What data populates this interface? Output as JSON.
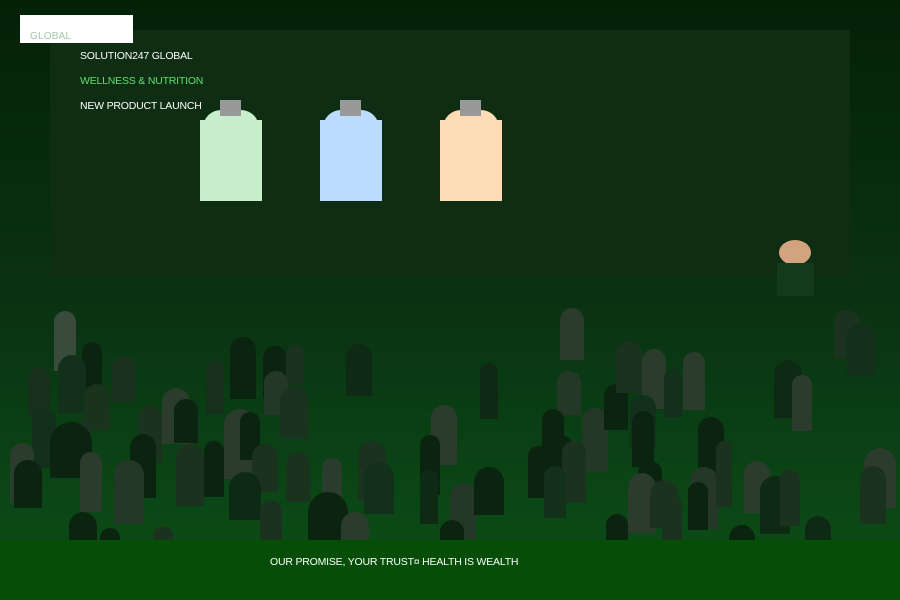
{
  "logo": {
    "text": "GLOBAL"
  },
  "screen": {
    "line1": "SOLUTION247 GLOBAL",
    "line2": "WELLNESS & NUTRITION",
    "line3": "NEW PRODUCT LAUNCH"
  },
  "bottles": [
    {
      "color": "#c8eecb"
    },
    {
      "color": "#bcdcfd"
    },
    {
      "color": "#fddbb4"
    }
  ],
  "footer": {
    "text": "OUR PROMISE, YOUR TRUST¤ HEALTH IS WEALTH"
  },
  "colors": {
    "accent_green": "#5ee06a",
    "screen": "#0e2d13",
    "footer_bar": "#064e07",
    "speaker_skin": "#d2a37e"
  }
}
